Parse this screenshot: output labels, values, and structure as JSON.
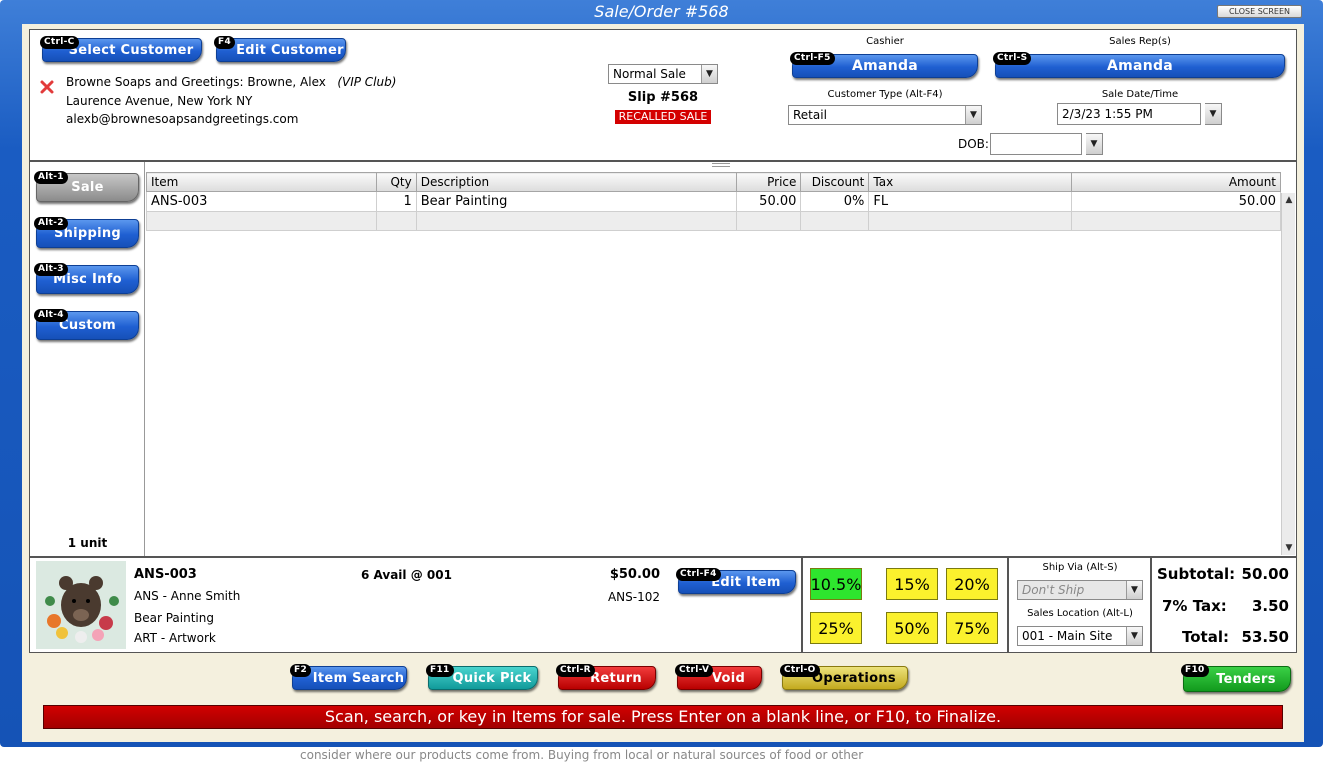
{
  "window": {
    "title": "Sale/Order #568",
    "close_label": "CLOSE SCREEN"
  },
  "below_text": "consider where our products come from. Buying from local or natural sources of food or other",
  "customer": {
    "select_label": "Select Customer",
    "select_key": "Ctrl-C",
    "edit_label": "Edit Customer",
    "edit_key": "F4",
    "line1": "Browne Soaps and Greetings: Browne, Alex",
    "club": "(VIP Club)",
    "line2": "Laurence Avenue, New York NY",
    "line3": "alexb@brownesoapsandgreetings.com"
  },
  "sale": {
    "type": "Normal Sale",
    "slip": "Slip #568",
    "recalled": "RECALLED SALE"
  },
  "cashier": {
    "label": "Cashier",
    "key": "Ctrl-F5",
    "name": "Amanda"
  },
  "sales_rep": {
    "label": "Sales Rep(s)",
    "key": "Ctrl-S",
    "name": "Amanda"
  },
  "customer_type": {
    "label": "Customer Type (Alt-F4)",
    "value": "Retail"
  },
  "sale_date": {
    "label": "Sale Date/Time",
    "value": "2/3/23 1:55 PM"
  },
  "dob": {
    "label": "DOB:",
    "value": ""
  },
  "tabs": [
    {
      "key": "Alt-1",
      "label": "Sale"
    },
    {
      "key": "Alt-2",
      "label": "Shipping"
    },
    {
      "key": "Alt-3",
      "label": "Misc Info"
    },
    {
      "key": "Alt-4",
      "label": "Custom"
    }
  ],
  "unit_count": "1 unit",
  "grid": {
    "headers": {
      "item": "Item",
      "qty": "Qty",
      "description": "Description",
      "price": "Price",
      "discount": "Discount",
      "tax": "Tax",
      "amount": "Amount"
    },
    "rows": [
      {
        "item": "ANS-003",
        "qty": "1",
        "description": "Bear Painting",
        "price": "50.00",
        "discount": "0%",
        "tax": "FL",
        "amount": "50.00"
      }
    ]
  },
  "detail": {
    "sku": "ANS-003",
    "vendor": "ANS - Anne Smith",
    "name": "Bear Painting",
    "category": "ART - Artwork",
    "avail": "6 Avail @ 001",
    "price": "$50.00",
    "alt_sku": "ANS-102",
    "edit_label": "Edit Item",
    "edit_key": "Ctrl-F4"
  },
  "discounts": [
    "10.5%",
    "15%",
    "20%",
    "25%",
    "50%",
    "75%"
  ],
  "ship_via": {
    "label": "Ship Via (Alt-S)",
    "value": "Don't Ship"
  },
  "sales_location": {
    "label": "Sales Location (Alt-L)",
    "value": "001 - Main Site"
  },
  "totals": {
    "subtotal_label": "Subtotal:",
    "subtotal": "50.00",
    "tax_label": "7% Tax:",
    "tax": "3.50",
    "total_label": "Total:",
    "total": "53.50"
  },
  "actions": {
    "item_search": {
      "key": "F2",
      "label": "Item Search"
    },
    "quick_pick": {
      "key": "F11",
      "label": "Quick Pick"
    },
    "return": {
      "key": "Ctrl-R",
      "label": "Return"
    },
    "void": {
      "key": "Ctrl-V",
      "label": "Void"
    },
    "operations": {
      "key": "Ctrl-O",
      "label": "Operations"
    },
    "tenders": {
      "key": "F10",
      "label": "Tenders"
    }
  },
  "status": "Scan, search, or key in Items for sale. Press Enter on a blank line, or F10, to Finalize."
}
